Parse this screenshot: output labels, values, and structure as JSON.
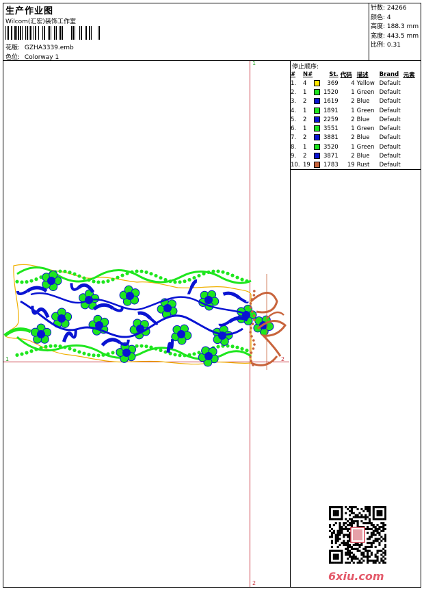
{
  "header": {
    "title": "生产作业图",
    "company": "Wilcom(汇宏)装饰工作室",
    "design_name_label": "花版:",
    "design_name": "GZHA3339.emb",
    "colorway_label": "色位:",
    "colorway": "Colorway 1"
  },
  "stats": {
    "stitches_label": "针数:",
    "stitches": "24266",
    "colors_label": "颜色:",
    "colors": "4",
    "height_label": "高度:",
    "height": "188.3 mm",
    "width_label": "宽度:",
    "width": "443.5 mm",
    "scale_label": "比例:",
    "scale": "0.31"
  },
  "sequence": {
    "title": "停止顺序:",
    "headers": [
      "#",
      "N#",
      "St.",
      "代码",
      "描述",
      "Brand",
      "元素"
    ],
    "rows": [
      {
        "idx": "1.",
        "n": "4",
        "color": "#ffe600",
        "st": "369",
        "code": "4",
        "desc": "Yellow",
        "brand": "Default"
      },
      {
        "idx": "2.",
        "n": "1",
        "color": "#1ee61e",
        "st": "1520",
        "code": "1",
        "desc": "Green",
        "brand": "Default"
      },
      {
        "idx": "3.",
        "n": "2",
        "color": "#0a14d2",
        "st": "1619",
        "code": "2",
        "desc": "Blue",
        "brand": "Default"
      },
      {
        "idx": "4.",
        "n": "1",
        "color": "#1ee61e",
        "st": "1891",
        "code": "1",
        "desc": "Green",
        "brand": "Default"
      },
      {
        "idx": "5.",
        "n": "2",
        "color": "#0a14d2",
        "st": "2259",
        "code": "2",
        "desc": "Blue",
        "brand": "Default"
      },
      {
        "idx": "6.",
        "n": "1",
        "color": "#1ee61e",
        "st": "3551",
        "code": "1",
        "desc": "Green",
        "brand": "Default"
      },
      {
        "idx": "7.",
        "n": "2",
        "color": "#0a14d2",
        "st": "3881",
        "code": "2",
        "desc": "Blue",
        "brand": "Default"
      },
      {
        "idx": "8.",
        "n": "1",
        "color": "#1ee61e",
        "st": "3520",
        "code": "1",
        "desc": "Green",
        "brand": "Default"
      },
      {
        "idx": "9.",
        "n": "2",
        "color": "#0a14d2",
        "st": "3871",
        "code": "2",
        "desc": "Blue",
        "brand": "Default"
      },
      {
        "idx": "10.",
        "n": "19",
        "color": "#c8643c",
        "st": "1783",
        "code": "19",
        "desc": "Rust",
        "brand": "Default"
      }
    ]
  },
  "markers": {
    "top": "1",
    "bottom": "2",
    "left": "1",
    "right": "2"
  },
  "watermark": "6xiu.com",
  "colors": {
    "yellow": "#ffe600",
    "green": "#1ee61e",
    "blue": "#0a14d2",
    "rust": "#c8643c",
    "guide": "#c8323c"
  }
}
